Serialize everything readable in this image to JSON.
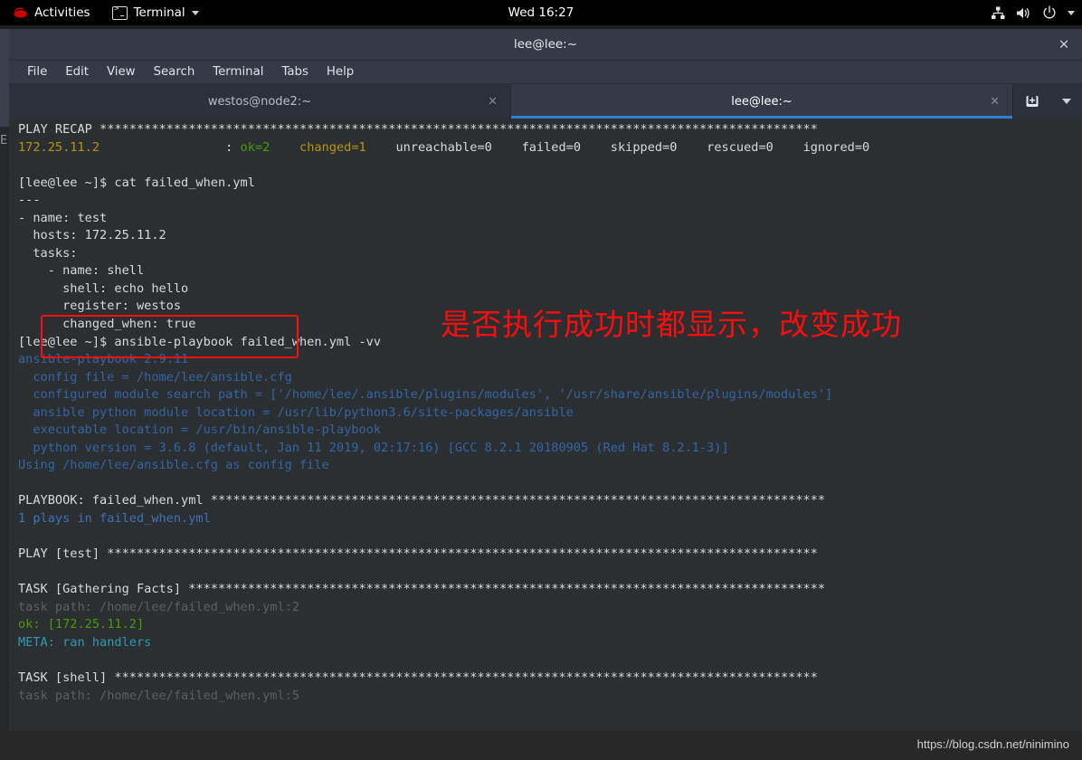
{
  "topbar": {
    "activities": "Activities",
    "app_name": "Terminal",
    "clock": "Wed 16:27",
    "icons": {
      "redhat": "redhat-logo-icon",
      "terminal": "terminal-icon",
      "app_caret": "chevron-down-icon",
      "network": "network-icon",
      "volume": "volume-icon",
      "power": "power-icon",
      "system_caret": "chevron-down-icon"
    }
  },
  "window": {
    "title": "lee@lee:~",
    "close_label": "×",
    "menu": [
      "File",
      "Edit",
      "View",
      "Search",
      "Terminal",
      "Tabs",
      "Help"
    ],
    "tabs": [
      {
        "label": "westos@node2:~",
        "active": false,
        "close_label": "×"
      },
      {
        "label": "lee@lee:~",
        "active": true,
        "close_label": "×"
      }
    ],
    "tab_tools": {
      "new_tab": "new-tab-icon",
      "tab_menu": "chevron-down-icon"
    }
  },
  "behind_window": {
    "edge_char": "E"
  },
  "terminal": {
    "lines": [
      {
        "segs": [
          {
            "t": "PLAY RECAP ",
            "c": "c-white"
          },
          {
            "t": "*************************************************************************************************",
            "c": "c-white"
          }
        ]
      },
      {
        "segs": [
          {
            "t": "172.25.11.2",
            "c": "c-yellow"
          },
          {
            "t": "                 : ",
            "c": "c-white"
          },
          {
            "t": "ok=2",
            "c": "c-green"
          },
          {
            "t": "    ",
            "c": "c-white"
          },
          {
            "t": "changed=1",
            "c": "c-yellow"
          },
          {
            "t": "    unreachable=0    failed=0    skipped=0    rescued=0    ignored=0",
            "c": "c-white"
          }
        ]
      },
      {
        "segs": []
      },
      {
        "segs": [
          {
            "t": "[lee@lee ~]$ cat failed_when.yml",
            "c": "c-white"
          }
        ]
      },
      {
        "segs": [
          {
            "t": "---",
            "c": "c-white"
          }
        ]
      },
      {
        "segs": [
          {
            "t": "- name: test",
            "c": "c-white"
          }
        ]
      },
      {
        "segs": [
          {
            "t": "  hosts: 172.25.11.2",
            "c": "c-white"
          }
        ]
      },
      {
        "segs": [
          {
            "t": "  tasks:",
            "c": "c-white"
          }
        ]
      },
      {
        "segs": [
          {
            "t": "    - name: shell",
            "c": "c-white"
          }
        ]
      },
      {
        "segs": [
          {
            "t": "      shell: echo hello",
            "c": "c-white"
          }
        ]
      },
      {
        "segs": [
          {
            "t": "      register: westos",
            "c": "c-white"
          }
        ]
      },
      {
        "segs": [
          {
            "t": "      changed_when: true",
            "c": "c-white"
          }
        ]
      },
      {
        "segs": [
          {
            "t": "[lee@lee ~]$ ansible-playbook failed_when.yml -vv",
            "c": "c-white"
          }
        ]
      },
      {
        "segs": [
          {
            "t": "ansible-playbook 2.9.11",
            "c": "c-blue"
          }
        ]
      },
      {
        "segs": [
          {
            "t": "  config file = /home/lee/ansible.cfg",
            "c": "c-blue"
          }
        ]
      },
      {
        "segs": [
          {
            "t": "  configured module search path = ['/home/lee/.ansible/plugins/modules', '/usr/share/ansible/plugins/modules']",
            "c": "c-blue"
          }
        ]
      },
      {
        "segs": [
          {
            "t": "  ansible python module location = /usr/lib/python3.6/site-packages/ansible",
            "c": "c-blue"
          }
        ]
      },
      {
        "segs": [
          {
            "t": "  executable location = /usr/bin/ansible-playbook",
            "c": "c-blue"
          }
        ]
      },
      {
        "segs": [
          {
            "t": "  python version = 3.6.8 (default, Jan 11 2019, 02:17:16) [GCC 8.2.1 20180905 (Red Hat 8.2.1-3)]",
            "c": "c-blue"
          }
        ]
      },
      {
        "segs": [
          {
            "t": "Using /home/lee/ansible.cfg as config file",
            "c": "c-blue"
          }
        ]
      },
      {
        "segs": []
      },
      {
        "segs": [
          {
            "t": "PLAYBOOK: failed_when.yml ",
            "c": "c-white"
          },
          {
            "t": "***********************************************************************************",
            "c": "c-white"
          }
        ]
      },
      {
        "segs": [
          {
            "t": "1 plays in failed_when.yml",
            "c": "c-blue2"
          }
        ]
      },
      {
        "segs": []
      },
      {
        "segs": [
          {
            "t": "PLAY [test] ",
            "c": "c-white"
          },
          {
            "t": "************************************************************************************************",
            "c": "c-white"
          }
        ]
      },
      {
        "segs": []
      },
      {
        "segs": [
          {
            "t": "TASK [Gathering Facts] ",
            "c": "c-white"
          },
          {
            "t": "**************************************************************************************",
            "c": "c-white"
          }
        ]
      },
      {
        "segs": [
          {
            "t": "task path: /home/lee/failed_when.yml:2",
            "c": "c-gray"
          }
        ]
      },
      {
        "segs": [
          {
            "t": "ok: [172.25.11.2]",
            "c": "c-green"
          }
        ]
      },
      {
        "segs": [
          {
            "t": "META: ran handlers",
            "c": "c-cyan"
          }
        ]
      },
      {
        "segs": []
      },
      {
        "segs": [
          {
            "t": "TASK [shell] ",
            "c": "c-white"
          },
          {
            "t": "***********************************************************************************************",
            "c": "c-white"
          }
        ]
      },
      {
        "segs": [
          {
            "t": "task path: /home/lee/failed_when.yml:5",
            "c": "c-gray"
          }
        ]
      }
    ]
  },
  "annotations": {
    "highlight_box": {
      "label": "changed-when-highlight"
    },
    "chinese_note": "是否执行成功时都显示，改变成功"
  },
  "footer": {
    "watermark": "https://blog.csdn.net/ninimino"
  },
  "colors": {
    "terminal_bg": "#2b2f31",
    "window_chrome": "#353a46",
    "tabbar_bg": "#2b303b",
    "active_tab_underline": "#2f7fd1",
    "annotation_red": "#ff1010",
    "topbar_bg": "#000000"
  }
}
